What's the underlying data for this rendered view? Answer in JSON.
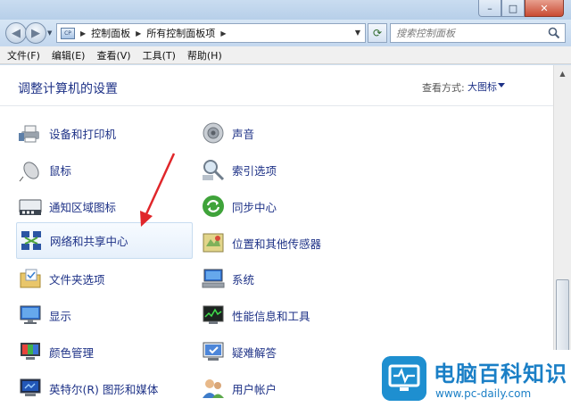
{
  "window": {
    "caption_minimize": "–",
    "caption_maximize": "□",
    "caption_close": "✕"
  },
  "address_bar": {
    "icon_text": "CP",
    "breadcrumbs": [
      "控制面板",
      "所有控制面板项"
    ]
  },
  "search": {
    "placeholder": "搜索控制面板"
  },
  "menu": [
    "文件(F)",
    "编辑(E)",
    "查看(V)",
    "工具(T)",
    "帮助(H)"
  ],
  "main": {
    "title": "调整计算机的设置",
    "view_label": "查看方式:",
    "view_value": "大图标"
  },
  "items_left": [
    {
      "label": "设备和打印机",
      "icon": "printer-icon"
    },
    {
      "label": "鼠标",
      "icon": "mouse-icon"
    },
    {
      "label": "通知区域图标",
      "icon": "notification-area-icon"
    },
    {
      "label": "网络和共享中心",
      "icon": "network-center-icon",
      "selected": true
    },
    {
      "label": "文件夹选项",
      "icon": "folder-options-icon"
    },
    {
      "label": "显示",
      "icon": "display-icon"
    },
    {
      "label": "颜色管理",
      "icon": "color-management-icon"
    },
    {
      "label": "英特尔(R) 图形和媒体",
      "icon": "intel-graphics-icon"
    }
  ],
  "items_right": [
    {
      "label": "声音",
      "icon": "speaker-icon"
    },
    {
      "label": "索引选项",
      "icon": "index-search-icon"
    },
    {
      "label": "同步中心",
      "icon": "sync-icon"
    },
    {
      "label": "位置和其他传感器",
      "icon": "sensor-icon"
    },
    {
      "label": "系统",
      "icon": "system-icon"
    },
    {
      "label": "性能信息和工具",
      "icon": "performance-icon"
    },
    {
      "label": "疑难解答",
      "icon": "troubleshoot-icon"
    },
    {
      "label": "用户帐户",
      "icon": "user-accounts-icon"
    }
  ],
  "watermark": {
    "title": "电脑百科知识",
    "url": "www.pc-daily.com"
  },
  "colors": {
    "link": "#1e3287",
    "annotation_arrow": "#e0262a",
    "watermark": "#1a7fc6"
  }
}
